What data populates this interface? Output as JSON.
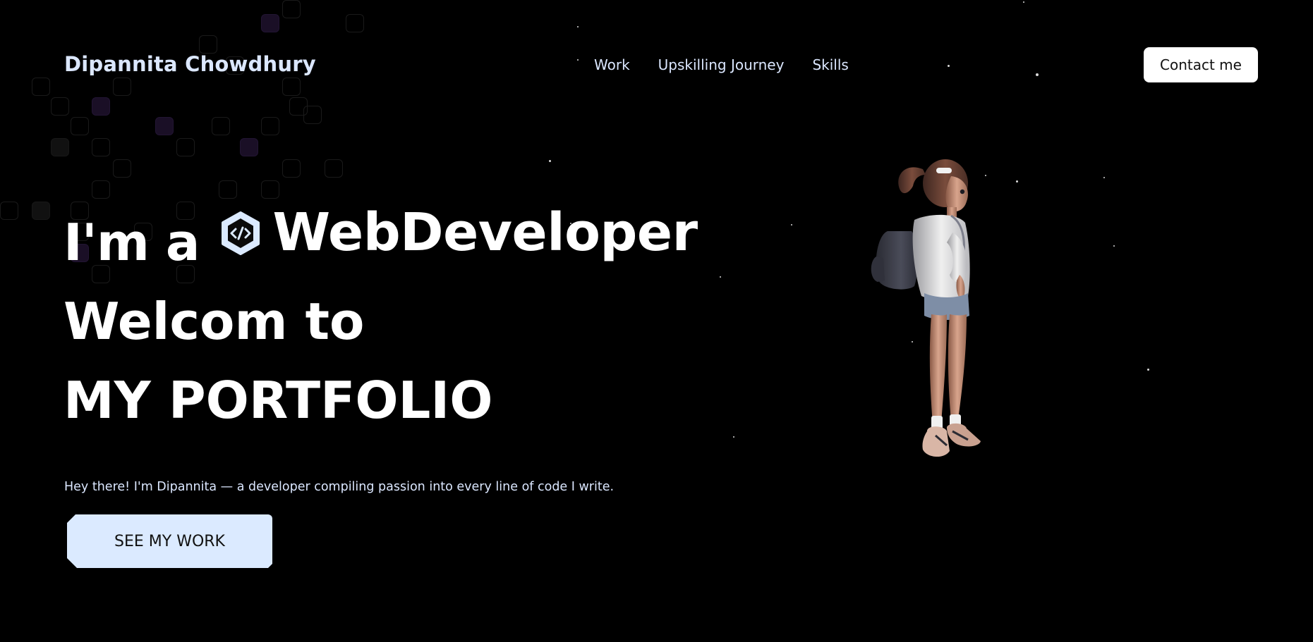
{
  "header": {
    "logo_text": "Dipannita Chowdhury",
    "nav": [
      {
        "label": "Work"
      },
      {
        "label": "Upskilling Journey"
      },
      {
        "label": "Skills"
      }
    ],
    "contact_label": "Contact me"
  },
  "hero": {
    "line1_prefix": "I'm a",
    "role_icon": "code-icon",
    "role_text": "WebDeveloper",
    "line2": "Welcom to",
    "line3": "MY PORTFOLIO",
    "tagline": "Hey there! I'm Dipannita — a developer compiling passion into every line of code I write.",
    "cta_label": "SEE MY WORK"
  },
  "illustration": {
    "name": "3d-character-girl-with-backpack"
  },
  "colors": {
    "background": "#000000",
    "text_light": "#dbe7ff",
    "cta_background": "#dbeaff",
    "contact_background": "#ffffff"
  }
}
